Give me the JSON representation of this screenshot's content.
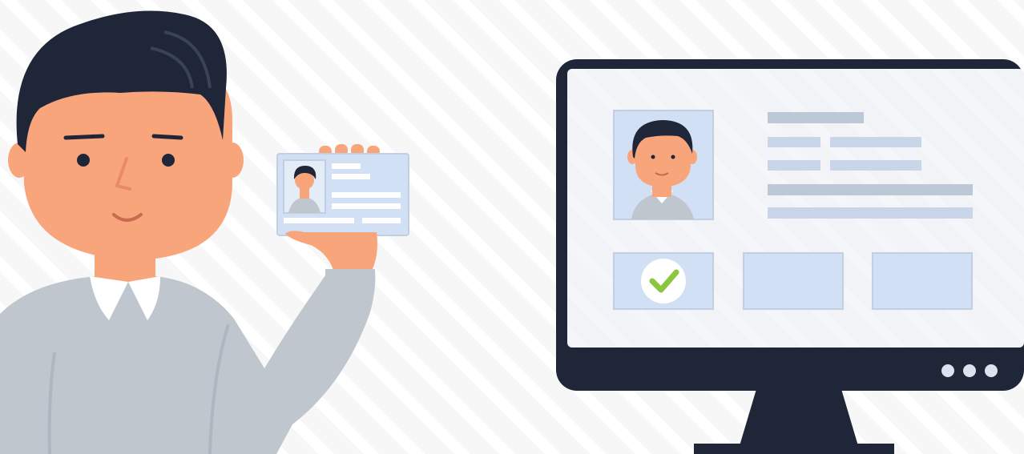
{
  "scene": {
    "colors": {
      "background": "#f7f7f7",
      "stripe": "#ffffff",
      "skin": "#f9a57c",
      "skin_shadow": "#e8896a",
      "hair": "#1f2638",
      "sweater": "#bfc6ce",
      "collar": "#ffffff",
      "monitor_frame": "#1f2638",
      "screen": "#eef1f6",
      "panel": "#d2e0f5",
      "panel_border": "#c2cfe3",
      "bar": "#c9d6ea",
      "bar_dark": "#bcc8d6",
      "check": "#8cc63f",
      "indicator": "#dbe3ee"
    },
    "icons": [
      "check-icon",
      "power-indicator-icon"
    ],
    "indicator_count": 3,
    "verification_status": "verified"
  }
}
